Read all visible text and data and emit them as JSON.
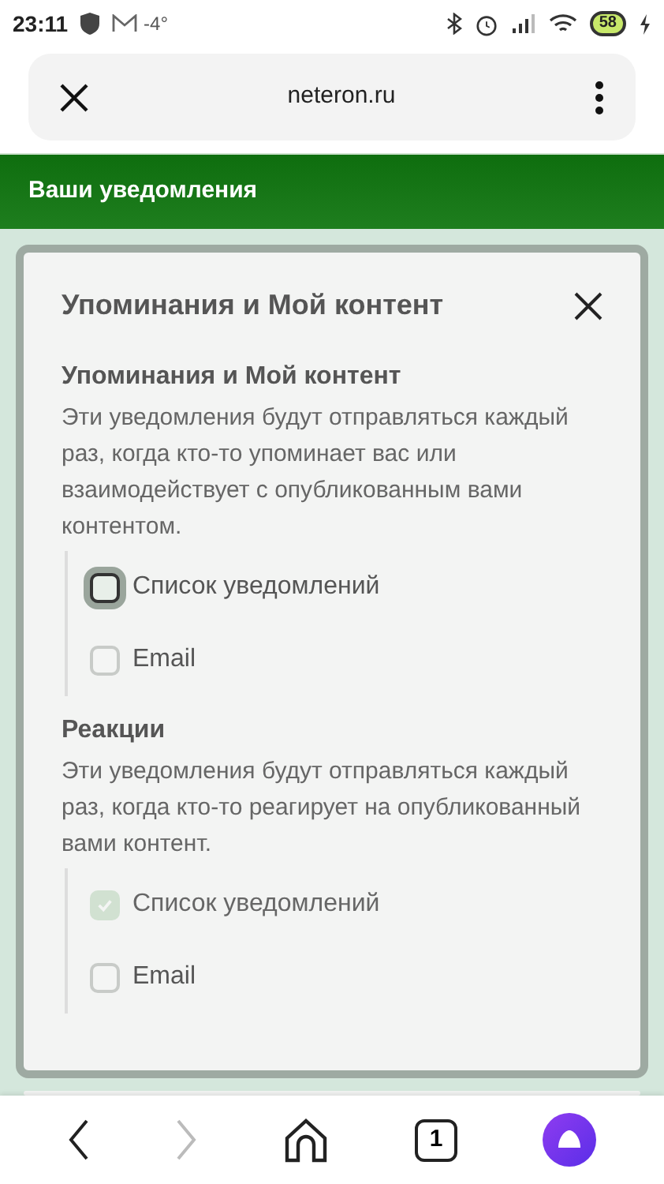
{
  "status_bar": {
    "time": "23:11",
    "temperature": "-4°",
    "battery": "58"
  },
  "browser": {
    "url": "neteron.ru"
  },
  "header": {
    "title": "Ваши уведомления"
  },
  "dialog": {
    "title": "Упоминания и Мой контент",
    "sections": [
      {
        "title": "Упоминания и Мой контент",
        "description": "Эти уведомления будут отправляться каждый раз, когда кто-то упоминает вас или взаимодействует с опубликованным вами контентом.",
        "options": [
          {
            "label": "Список уведомлений",
            "checked": false,
            "disabled": false,
            "focused": true
          },
          {
            "label": "Email",
            "checked": false,
            "disabled": false,
            "focused": false
          }
        ]
      },
      {
        "title": "Реакции",
        "description": "Эти уведомления будут отправляться каждый раз, когда кто-то реагирует на опубликованный вами контент.",
        "options": [
          {
            "label": "Список уведомлений",
            "checked": true,
            "disabled": true,
            "focused": false
          },
          {
            "label": "Email",
            "checked": false,
            "disabled": false,
            "focused": false
          }
        ]
      }
    ]
  },
  "bottom_nav": {
    "tab_count": "1",
    "forward_disabled": true
  }
}
